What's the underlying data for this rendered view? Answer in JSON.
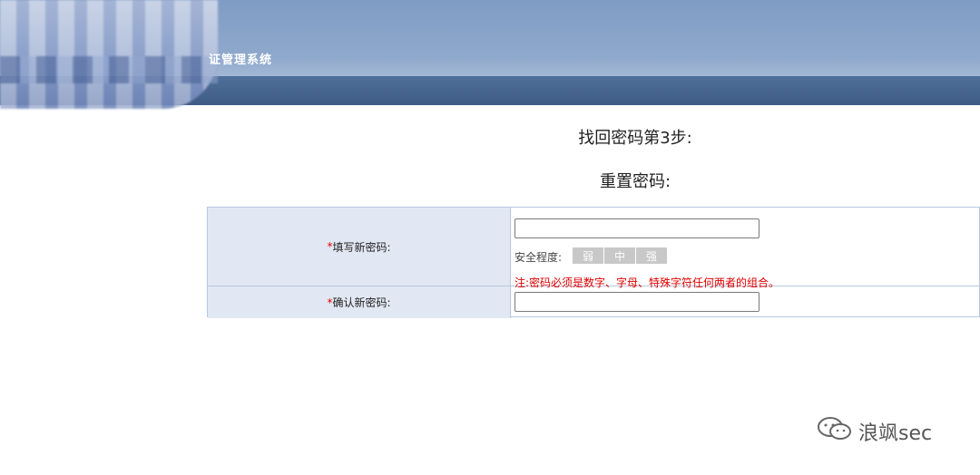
{
  "header": {
    "system_title": "证管理系统"
  },
  "page": {
    "step_title": "找回密码第3步:",
    "sub_title": "重置密码:"
  },
  "form": {
    "required_mark": "*",
    "new_password_label": "填写新密码:",
    "new_password_value": "",
    "strength_label": "安全程度:",
    "strength_levels": [
      "弱",
      "中",
      "强"
    ],
    "note": "注:密码必须是数字、字母、特殊字符任何两者的组合。",
    "confirm_password_label": "确认新密码:",
    "confirm_password_value": ""
  },
  "watermark": {
    "icon": "wechat-icon",
    "text": "浪飒sec"
  }
}
